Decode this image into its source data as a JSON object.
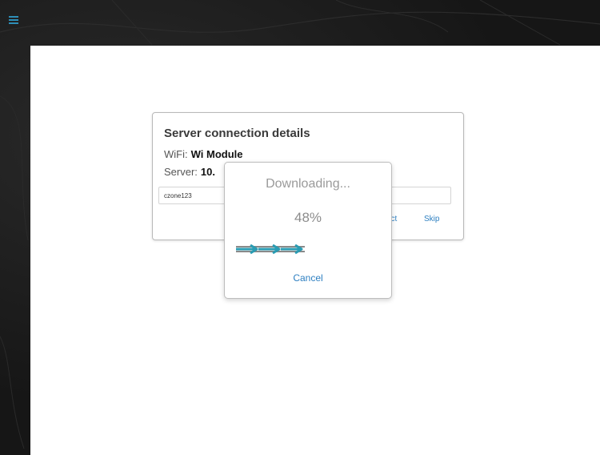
{
  "colors": {
    "accent": "#2d7fc1",
    "menu_icon": "#2e8fb8",
    "progress_bar": "#2a9cb3",
    "backdrop": "#161616"
  },
  "header": {
    "menu_icon": "hamburger-menu-icon"
  },
  "connection_dialog": {
    "title": "Server connection details",
    "wifi_label": "WiFi:",
    "wifi_value": "Wi Module",
    "server_label": "Server:",
    "server_value": "10.",
    "password_value": "czone123",
    "connect_label": "ect",
    "skip_label": "Skip"
  },
  "progress_dialog": {
    "title": "Downloading...",
    "percent_label": "48%",
    "progress": 0.48,
    "cancel_label": "Cancel"
  }
}
